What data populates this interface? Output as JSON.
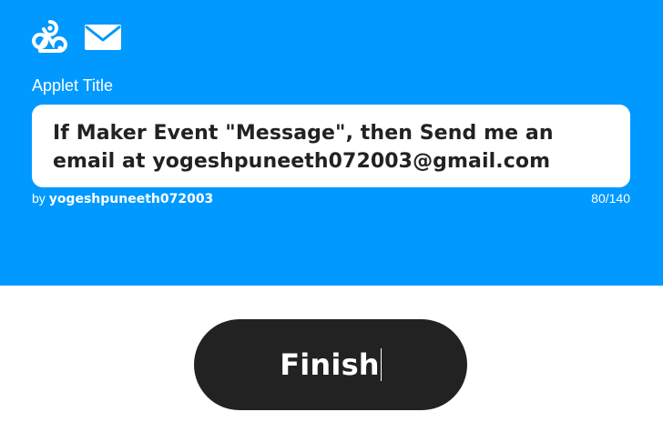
{
  "hero": {
    "background_color": "#0099ff",
    "service_icons": [
      "webhooks-icon",
      "email-icon"
    ],
    "title_label": "Applet Title",
    "title_value": "If Maker Event \"Message\", then Send me an email at yogeshpuneeth072003@gmail.com",
    "byline_prefix": "by",
    "author": "yogeshpuneeth072003",
    "char_count": "80/140"
  },
  "finish_button": {
    "label": "Finish",
    "background_color": "#222222"
  }
}
